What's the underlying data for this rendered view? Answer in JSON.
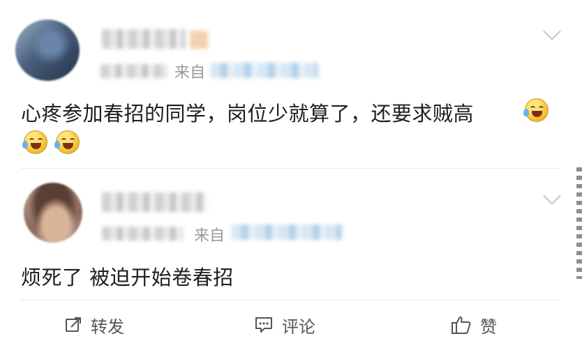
{
  "comments": [
    {
      "source_prefix": "来自",
      "text": "心疼参加春招的同学，岗位少就算了，还要求贼高",
      "emoji": "laugh-cry-emoji"
    },
    {
      "source_prefix": "来自",
      "text": "烦死了 被迫开始卷春招"
    }
  ],
  "actions": {
    "repost_label": "转发",
    "comment_label": "评论",
    "like_label": "赞"
  },
  "colors": {
    "text": "#1e1e1e",
    "muted": "#9a9a9a",
    "divider": "#e8e8e8"
  }
}
